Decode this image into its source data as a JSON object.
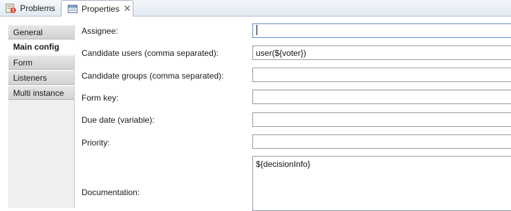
{
  "tabs": [
    {
      "label": "Problems",
      "icon": "problems-icon"
    },
    {
      "label": "Properties",
      "icon": "properties-icon",
      "close": "☒"
    }
  ],
  "sidebar": {
    "items": [
      {
        "label": "General"
      },
      {
        "label": "Main config",
        "active": true
      },
      {
        "label": "Form"
      },
      {
        "label": "Listeners"
      },
      {
        "label": "Multi instance"
      }
    ]
  },
  "form": {
    "assignee": {
      "label": "Assignee:",
      "value": ""
    },
    "candidate_users": {
      "label": "Candidate users (comma separated):",
      "value": "user(${voter})"
    },
    "candidate_groups": {
      "label": "Candidate groups (comma separated):",
      "value": ""
    },
    "form_key": {
      "label": "Form key:",
      "value": ""
    },
    "due_date": {
      "label": "Due date (variable):",
      "value": ""
    },
    "priority": {
      "label": "Priority:",
      "value": ""
    },
    "documentation": {
      "label": "Documentation:",
      "value": "${decisionInfo}"
    }
  }
}
